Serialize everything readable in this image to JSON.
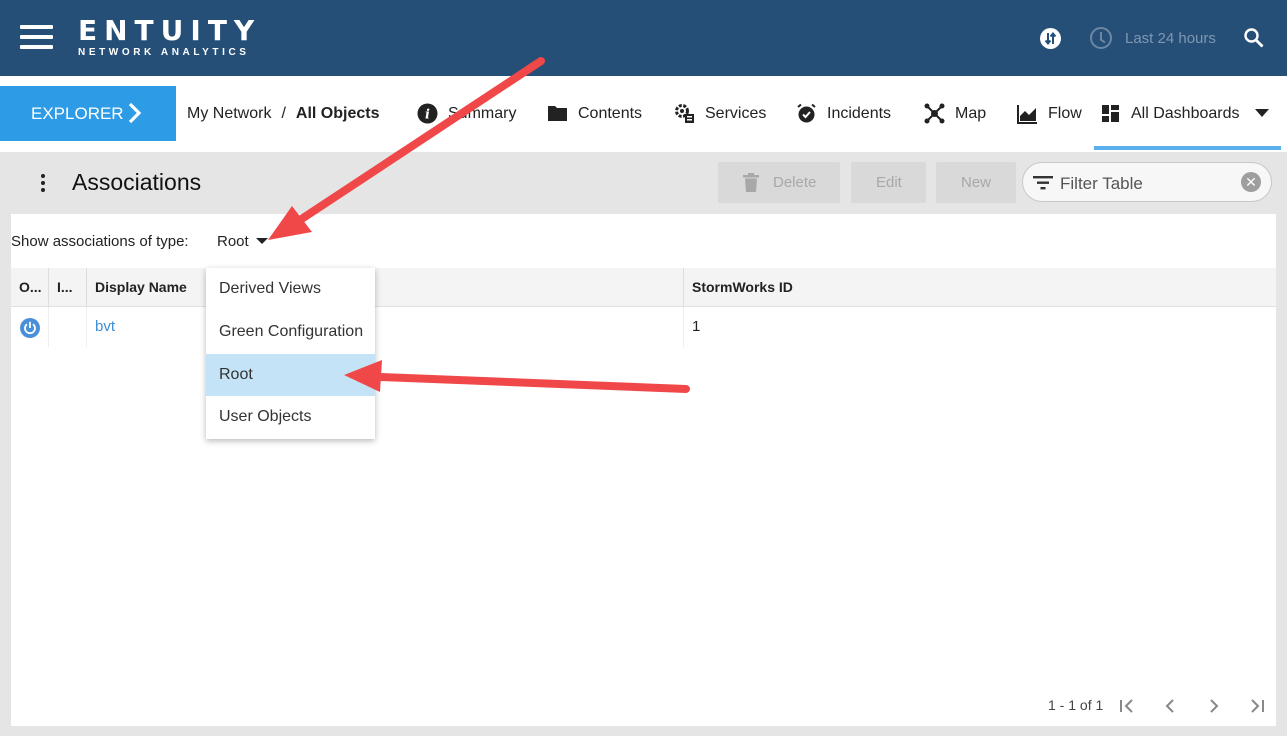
{
  "app": {
    "brand": "ENTUITY",
    "tagline": "NETWORK ANALYTICS",
    "time_range": "Last 24 hours"
  },
  "nav": {
    "explorer_label": "EXPLORER",
    "breadcrumb": [
      "My Network",
      "All Objects"
    ],
    "breadcrumb_sep": "/",
    "tabs": [
      {
        "label": "Summary",
        "icon": "info-icon"
      },
      {
        "label": "Contents",
        "icon": "folder-icon"
      },
      {
        "label": "Services",
        "icon": "services-gear-icon"
      },
      {
        "label": "Incidents",
        "icon": "alarm-clock-icon"
      },
      {
        "label": "Map",
        "icon": "network-map-icon"
      },
      {
        "label": "Flow",
        "icon": "flow-chart-icon"
      },
      {
        "label": "All Dashboards",
        "icon": "dashboard-grid-icon"
      }
    ]
  },
  "page": {
    "title": "Associations",
    "buttons": {
      "delete": "Delete",
      "edit": "Edit",
      "new": "New"
    },
    "filter_placeholder": "Filter Table",
    "type_label": "Show associations of type:",
    "type_value": "Root"
  },
  "table": {
    "columns": [
      "O...",
      "I...",
      "Display Name",
      "StormWorks ID"
    ],
    "rows": [
      {
        "display_name": "bvt",
        "stormworks_id": "1"
      }
    ]
  },
  "dropdown": {
    "options": [
      "Derived Views",
      "Green Configuration",
      "Root",
      "User Objects"
    ],
    "selected": "Root"
  },
  "pagination": {
    "summary": "1 - 1 of 1"
  },
  "colors": {
    "header_bg": "#264f78",
    "accent": "#2e9be6",
    "selected_option": "#c5e3f6",
    "annotation_arrow": "#f04848"
  }
}
